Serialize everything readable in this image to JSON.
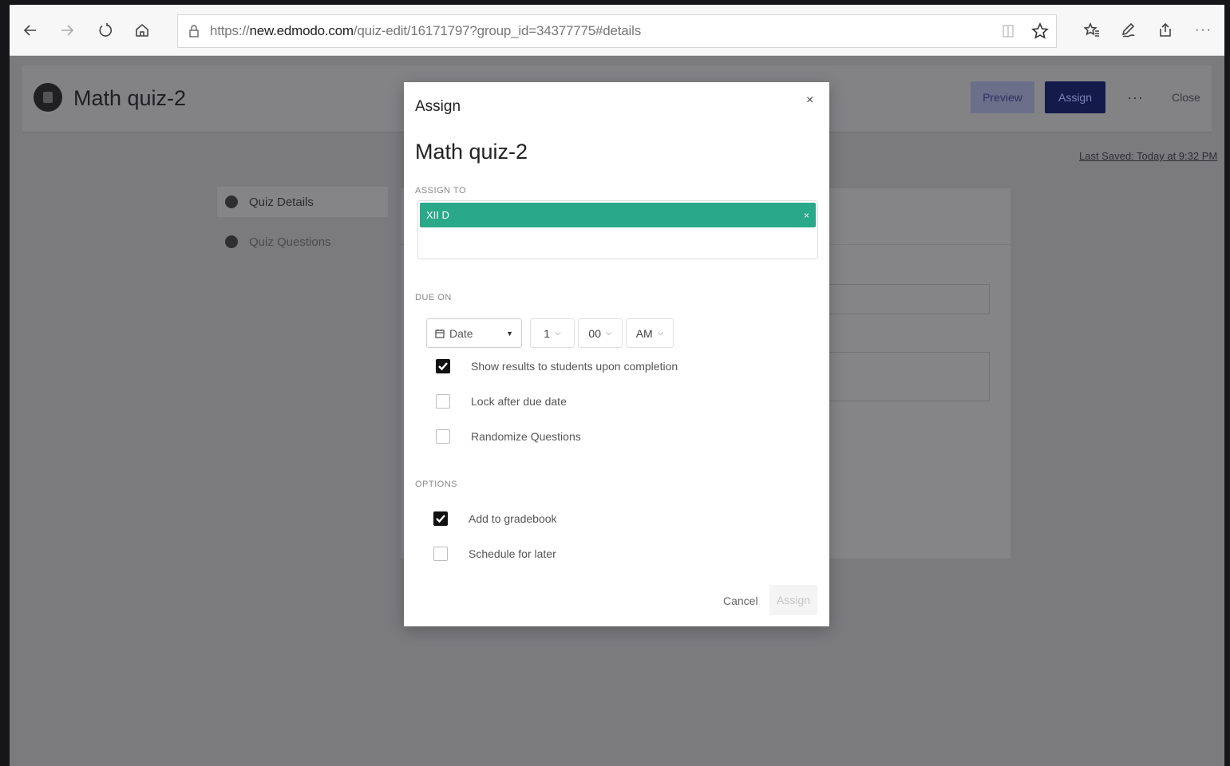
{
  "browser": {
    "url_prefix": "https://",
    "url_host": "new.edmodo.com",
    "url_path": "/quiz-edit/16171797?group_id=34377775#details"
  },
  "app": {
    "title": "Math quiz-2",
    "preview_label": "Preview",
    "assign_label": "Assign",
    "more_label": "···",
    "close_label": "Close",
    "last_saved": "Last Saved: Today at 9:32 PM",
    "sidebar": [
      {
        "label": "Quiz Details"
      },
      {
        "label": "Quiz Questions"
      }
    ]
  },
  "modal": {
    "header": "Assign",
    "close_glyph": "×",
    "title": "Math quiz-2",
    "assign_to_label": "ASSIGN TO",
    "chip_label": "XII D",
    "chip_remove": "×",
    "due_on_label": "DUE ON",
    "date_placeholder": "Date",
    "hour": "1",
    "minute": "00",
    "ampm": "AM",
    "due_options": [
      {
        "label": "Show results to students upon completion",
        "checked": true
      },
      {
        "label": "Lock after due date",
        "checked": false
      },
      {
        "label": "Randomize Questions",
        "checked": false
      }
    ],
    "options_label": "OPTIONS",
    "options": [
      {
        "label": "Add to gradebook",
        "checked": true
      },
      {
        "label": "Schedule for later",
        "checked": false
      }
    ],
    "cancel_label": "Cancel",
    "assign_label": "Assign"
  },
  "colors": {
    "chip": "#2aa98a",
    "assign_button": "#141a4a",
    "overlay": "#7b7b7e"
  }
}
